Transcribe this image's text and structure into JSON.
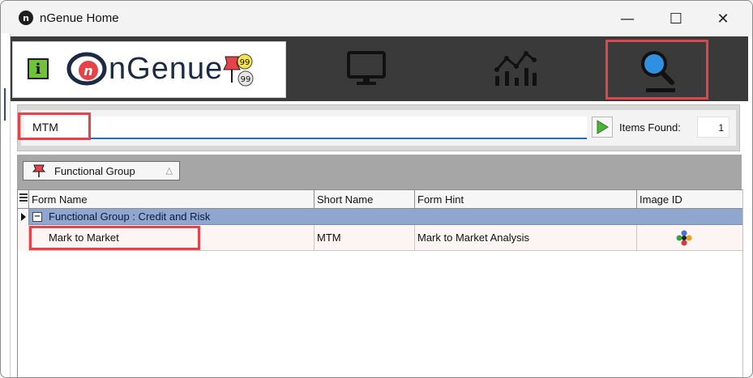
{
  "window": {
    "title": "nGenue Home",
    "app_icon_glyph": "n",
    "minimize_glyph": "—",
    "maximize_glyph": "☐",
    "close_glyph": "✕"
  },
  "header": {
    "logo_text": "nGenue",
    "info_glyph": "i",
    "notification_counts": [
      "99",
      "99"
    ],
    "nav": [
      {
        "name": "monitor-icon",
        "active": false
      },
      {
        "name": "analytics-chart-icon",
        "active": false
      },
      {
        "name": "search-icon",
        "active": true
      }
    ],
    "accent_color": "#e5424a",
    "bar_color": "#3a3a3a"
  },
  "search": {
    "value": "MTM",
    "items_found_label": "Items Found:",
    "items_found_value": "1"
  },
  "grouping": {
    "chip_label": "Functional Group",
    "sort_glyph": "△"
  },
  "grid": {
    "columns": [
      "Form Name",
      "Short Name",
      "Form Hint",
      "Image ID"
    ],
    "group_row": {
      "collapse_glyph": "−",
      "label": "Functional Group : Credit and Risk"
    },
    "rows": [
      {
        "form_name": "Mark to Market",
        "short_name": "MTM",
        "form_hint": "Mark to Market Analysis",
        "image_id_icon": "risk-analysis-icon"
      }
    ]
  }
}
